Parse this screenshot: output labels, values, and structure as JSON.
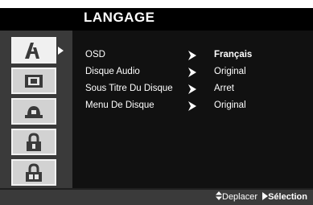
{
  "header": {
    "title": "LANGAGE"
  },
  "sidebar": {
    "tabs": [
      {
        "icon": "language-icon",
        "active": true
      },
      {
        "icon": "display-icon",
        "active": false
      },
      {
        "icon": "audio-icon",
        "active": false
      },
      {
        "icon": "lock-icon",
        "active": false
      },
      {
        "icon": "other-icon",
        "active": false
      }
    ]
  },
  "menu": {
    "items": [
      {
        "label": "OSD",
        "value": "Français"
      },
      {
        "label": "Disque Audio",
        "value": "Original"
      },
      {
        "label": "Sous Titre Du Disque",
        "value": "Arret"
      },
      {
        "label": "Menu De Disque",
        "value": "Original"
      }
    ]
  },
  "footer": {
    "move_label": "Deplacer",
    "select_label": "Sélection"
  },
  "colors": {
    "background": "#3a3a3a",
    "panel": "#111111",
    "title_bar": "#000000",
    "tab": "#d2d2d2",
    "text": "#ffffff"
  }
}
